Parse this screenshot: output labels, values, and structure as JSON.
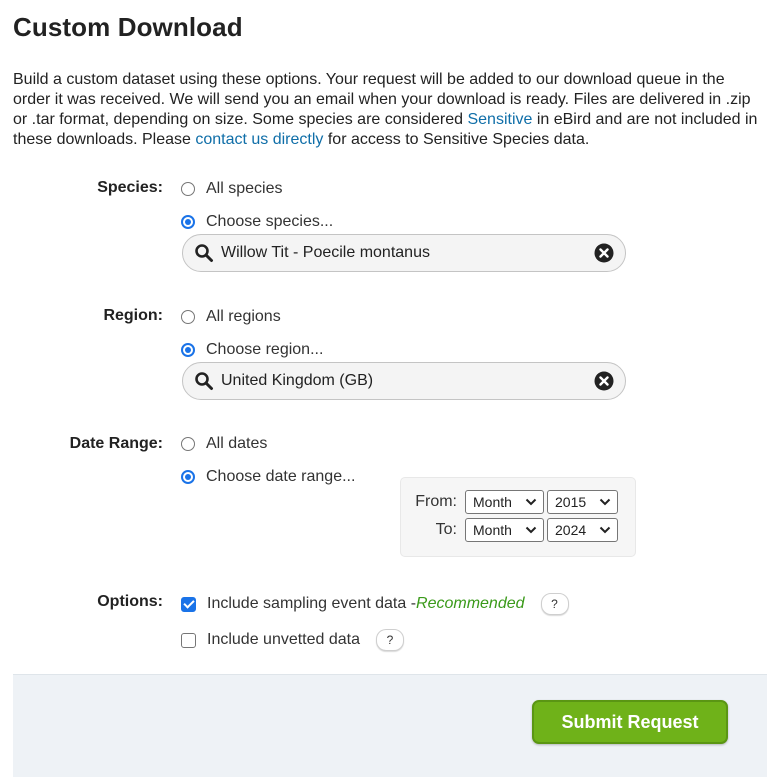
{
  "page": {
    "title": "Custom Download",
    "intro_before_sensitive": "Build a custom dataset using these options. Your request will be added to our download queue in the order it was received. We will send you an email when your download is ready. Files are delivered in .zip or .tar format, depending on size. Some species are considered ",
    "sensitive_link": "Sensitive",
    "intro_middle": " in eBird and are not included in these downloads. Please ",
    "contact_link": "contact us directly",
    "intro_after": " for access to Sensitive Species data."
  },
  "species": {
    "label": "Species:",
    "option_all": "All species",
    "option_choose": "Choose species...",
    "selected": "choose",
    "search_value": "Willow Tit - Poecile montanus"
  },
  "region": {
    "label": "Region:",
    "option_all": "All regions",
    "option_choose": "Choose region...",
    "selected": "choose",
    "search_value": "United Kingdom (GB)"
  },
  "date_range": {
    "label": "Date Range:",
    "option_all": "All dates",
    "option_choose": "Choose date range...",
    "selected": "choose",
    "from_label": "From:",
    "from_month": "Month",
    "from_year": "2015",
    "to_label": "To:",
    "to_month": "Month",
    "to_year": "2024"
  },
  "options": {
    "label": "Options:",
    "sampling_label": "Include sampling event data - ",
    "sampling_recommended": "Recommended",
    "sampling_checked": true,
    "unvetted_label": "Include unvetted data",
    "unvetted_checked": false,
    "help_text": "?"
  },
  "footer": {
    "submit_label": "Submit Request"
  },
  "colors": {
    "link": "#0f6ea8",
    "accent_blue": "#1a73e8",
    "submit_green": "#6fb219",
    "recommended_green": "#3a9a1a",
    "footer_bg": "#eef2f6"
  },
  "icons": [
    "magnifier-icon",
    "clear-icon",
    "chevron-down-icon",
    "help-icon"
  ]
}
